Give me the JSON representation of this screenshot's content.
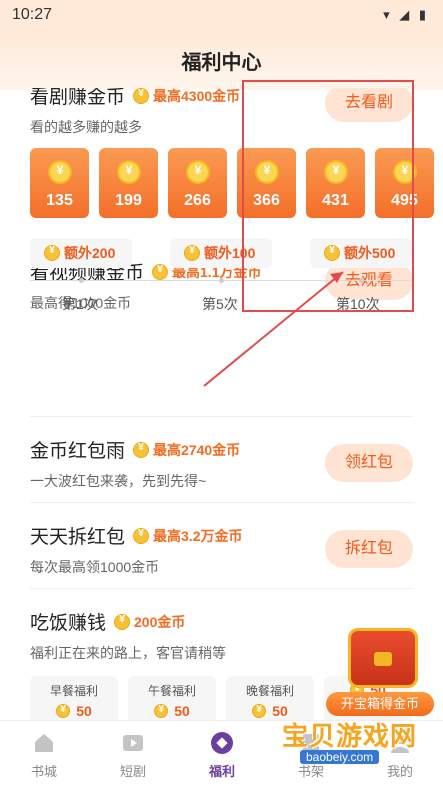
{
  "status": {
    "time": "10:27",
    "icons": "▾ ◢ ▮"
  },
  "header": {
    "title": "福利中心"
  },
  "drama": {
    "name": "看剧赚金币",
    "reward": "最高4300金币",
    "desc": "看的越多赚的越多",
    "button": "去看剧",
    "cards": [
      "135",
      "199",
      "266",
      "366",
      "431",
      "495"
    ]
  },
  "video": {
    "name": "看视频赚金币",
    "reward": "最高1.1万金币",
    "desc": "最高得1000金币",
    "button": "去观看",
    "extras": [
      {
        "label": "额外200",
        "step": "第1次"
      },
      {
        "label": "额外100",
        "step": "第5次"
      },
      {
        "label": "额外500",
        "step": "第10次"
      }
    ]
  },
  "rain": {
    "name": "金币红包雨",
    "reward": "最高2740金币",
    "desc": "一大波红包来袭，先到先得~",
    "button": "领红包"
  },
  "unpack": {
    "name": "天天拆红包",
    "reward": "最高3.2万金币",
    "desc": "每次最高领1000金币",
    "button": "拆红包"
  },
  "meal": {
    "name": "吃饭赚钱",
    "reward": "200金币",
    "desc": "福利正在来的路上，客官请稍等",
    "items": [
      {
        "title": "早餐福利",
        "value": "50"
      },
      {
        "title": "午餐福利",
        "value": "50"
      },
      {
        "title": "晚餐福利",
        "value": "50"
      },
      {
        "title": "",
        "value": "50"
      }
    ]
  },
  "chest": {
    "label": "开宝箱得金币"
  },
  "tabs": [
    "书城",
    "短剧",
    "福利",
    "书架",
    "我的"
  ],
  "watermark": {
    "title": "宝贝游戏网",
    "url": "baobeiy.com"
  },
  "colors": {
    "accent": "#f05b1c",
    "active_tab": "#6b3fa0",
    "annotation": "#e24b4b"
  }
}
